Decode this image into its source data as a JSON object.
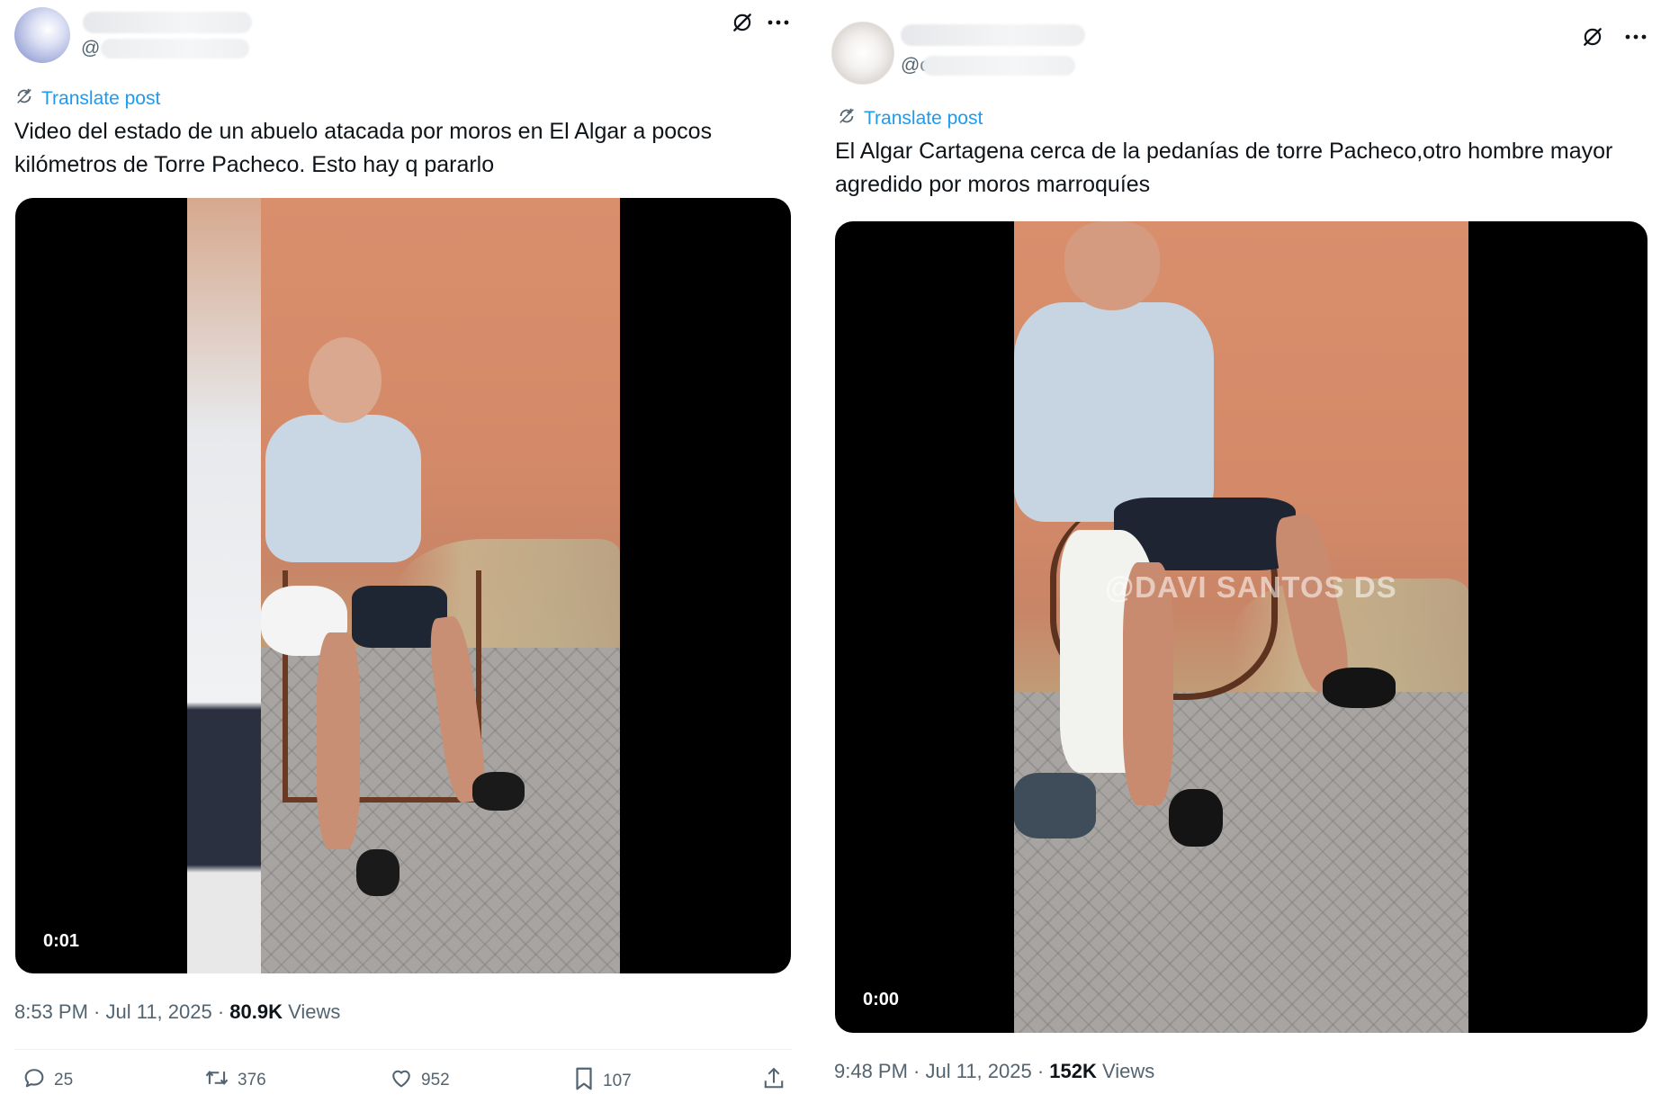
{
  "posts": [
    {
      "handle_prefix": "@",
      "translate_label": "Translate post",
      "text": "Video del estado de un abuelo atacada por moros en El Algar a pocos kilómetros de Torre Pacheco. Esto hay q pararlo",
      "video_time": "0:01",
      "timestamp": "8:53 PM · Jul 11, 2025 · ",
      "views_count": "80.9K",
      "views_label": " Views",
      "replies": "25",
      "reposts": "376",
      "likes": "952",
      "bookmarks": "107"
    },
    {
      "handle_prefix": "@c",
      "translate_label": "Translate post",
      "text": "El Algar Cartagena cerca de la pedanías de torre Pacheco,otro hombre mayor agredido por moros marroquíes",
      "video_time": "0:00",
      "watermark": "@DAVI SANTOS DS",
      "timestamp": "9:48 PM · Jul 11, 2025 · ",
      "views_count": "152K",
      "views_label": " Views"
    }
  ],
  "icons": {
    "grok": "grok-icon",
    "more": "more-icon",
    "translate": "translate-icon",
    "reply": "reply-icon",
    "repost": "repost-icon",
    "like": "heart-icon",
    "bookmark": "bookmark-icon",
    "share": "share-icon"
  },
  "colors": {
    "link": "#1d9bf0",
    "text": "#0f1419",
    "secondary": "#536471"
  }
}
